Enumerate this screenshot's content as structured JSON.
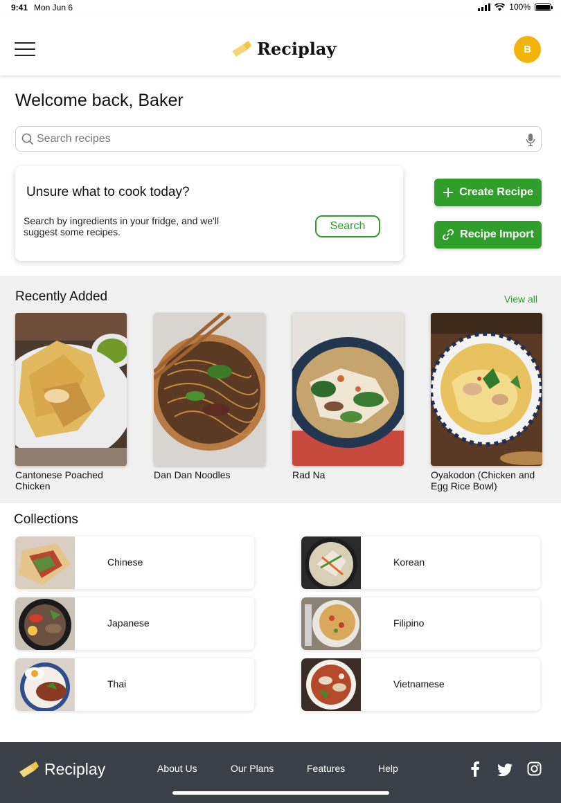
{
  "status": {
    "time": "9:41",
    "date": "Mon Jun 6",
    "battery": "100%"
  },
  "header": {
    "brand": "Reciplay",
    "avatar_initial": "B"
  },
  "welcome": "Welcome back, Baker",
  "search": {
    "placeholder": "Search recipes"
  },
  "prompt_card": {
    "title": "Unsure what to cook today?",
    "description": "Search by ingredients in your fridge, and we'll suggest some recipes.",
    "button": "Search"
  },
  "actions": {
    "create": "Create Recipe",
    "import": "Recipe Import"
  },
  "recent": {
    "title": "Recently Added",
    "view_all": "View all",
    "items": [
      {
        "name": "Cantonese Poached Chicken"
      },
      {
        "name": "Dan Dan Noodles"
      },
      {
        "name": "Rad Na"
      },
      {
        "name": "Oyakodon (Chicken and Egg Rice Bowl)"
      }
    ]
  },
  "collections": {
    "title": "Collections",
    "items": [
      {
        "label": "Chinese"
      },
      {
        "label": "Korean"
      },
      {
        "label": "Japanese"
      },
      {
        "label": "Filipino"
      },
      {
        "label": "Thai"
      },
      {
        "label": "Vietnamese"
      }
    ]
  },
  "footer": {
    "brand": "Reciplay",
    "links": [
      "About Us",
      "Our Plans",
      "Features",
      "Help"
    ],
    "social": [
      "facebook-icon",
      "twitter-icon",
      "instagram-icon"
    ]
  },
  "colors": {
    "accent_green": "#2f9e2b",
    "avatar_yellow": "#f2b40b",
    "footer_bg": "#3b3f47",
    "section_bg": "#f1f1f1"
  }
}
